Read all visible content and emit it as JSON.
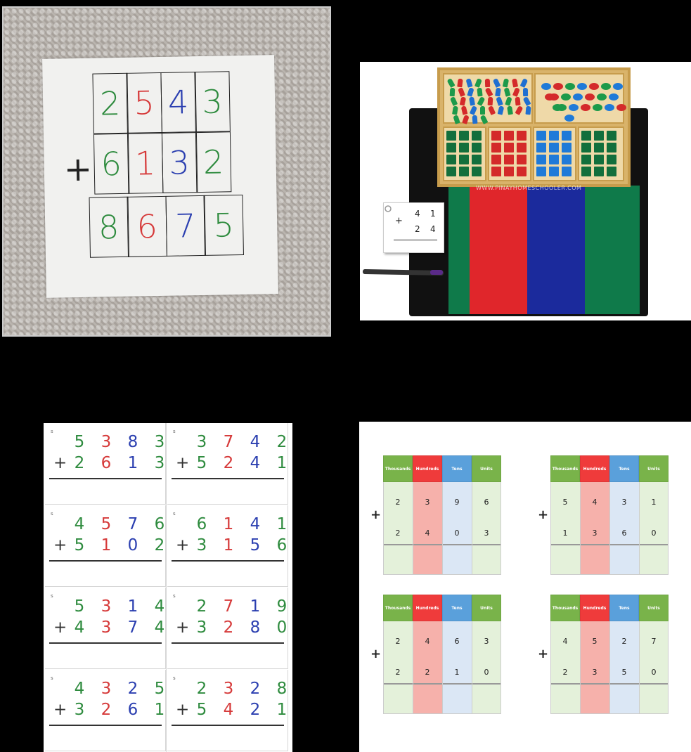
{
  "colors": {
    "thousands_green": "#2e8b3e",
    "hundreds_red": "#d63a3a",
    "tens_blue": "#2b3fb0",
    "units_green": "#2e8b3e",
    "pv_thousands": "#79b34a",
    "pv_hundreds": "#ef3b3b",
    "pv_tens": "#5aa0db",
    "pv_units": "#79b34a"
  },
  "panel1": {
    "sign": "+",
    "rows": [
      [
        "2",
        "5",
        "4",
        "3"
      ],
      [
        "6",
        "1",
        "3",
        "2"
      ],
      [
        "8",
        "6",
        "7",
        "5"
      ]
    ]
  },
  "panel2": {
    "card": {
      "sign": "+",
      "top": [
        "4",
        "1"
      ],
      "bottom": [
        "2",
        "4"
      ]
    },
    "watermark": "WWW.PINAYHOMESCHOOLER.COM",
    "tile_labels": [
      "1000",
      "100",
      "10",
      "1"
    ]
  },
  "panel3": {
    "cards": [
      {
        "s": "s",
        "top": [
          "5",
          "3",
          "8",
          "3"
        ],
        "bottom": [
          "2",
          "6",
          "1",
          "3"
        ]
      },
      {
        "s": "s",
        "top": [
          "3",
          "7",
          "4",
          "2"
        ],
        "bottom": [
          "5",
          "2",
          "4",
          "1"
        ]
      },
      {
        "s": "s",
        "top": [
          "4",
          "5",
          "7",
          "6"
        ],
        "bottom": [
          "5",
          "1",
          "0",
          "2"
        ]
      },
      {
        "s": "s",
        "top": [
          "6",
          "1",
          "4",
          "1"
        ],
        "bottom": [
          "3",
          "1",
          "5",
          "6"
        ]
      },
      {
        "s": "s",
        "top": [
          "5",
          "3",
          "1",
          "4"
        ],
        "bottom": [
          "4",
          "3",
          "7",
          "4"
        ]
      },
      {
        "s": "s",
        "top": [
          "2",
          "7",
          "1",
          "9"
        ],
        "bottom": [
          "3",
          "2",
          "8",
          "0"
        ]
      },
      {
        "s": "s",
        "top": [
          "4",
          "3",
          "2",
          "5"
        ],
        "bottom": [
          "3",
          "2",
          "6",
          "1"
        ]
      },
      {
        "s": "s",
        "top": [
          "2",
          "3",
          "2",
          "8"
        ],
        "bottom": [
          "5",
          "4",
          "2",
          "1"
        ]
      }
    ],
    "sign": "+"
  },
  "panel4": {
    "headers": [
      "Thousands",
      "Hundreds",
      "Tens",
      "Units"
    ],
    "sign": "+",
    "tables": [
      {
        "top": [
          "2",
          "3",
          "9",
          "6"
        ],
        "bottom": [
          "2",
          "4",
          "0",
          "3"
        ]
      },
      {
        "top": [
          "5",
          "4",
          "3",
          "1"
        ],
        "bottom": [
          "1",
          "3",
          "6",
          "0"
        ]
      },
      {
        "top": [
          "2",
          "4",
          "6",
          "3"
        ],
        "bottom": [
          "2",
          "2",
          "1",
          "0"
        ]
      },
      {
        "top": [
          "4",
          "5",
          "2",
          "7"
        ],
        "bottom": [
          "2",
          "3",
          "5",
          "0"
        ]
      }
    ]
  }
}
